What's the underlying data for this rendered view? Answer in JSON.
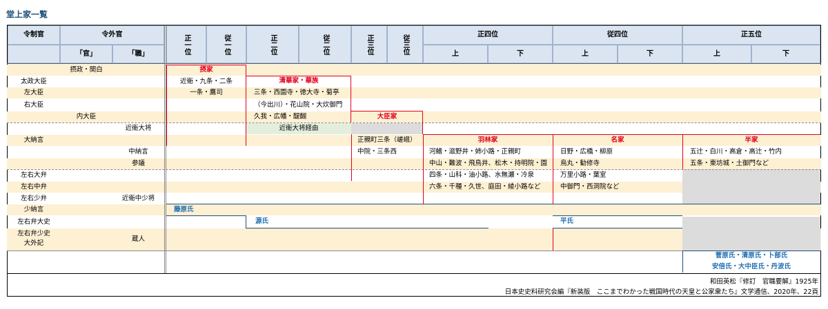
{
  "title": "堂上家一覧",
  "headers": {
    "ryoseikan": "令制官",
    "ryogekan": "令外官",
    "kan": "「官」",
    "shoku": "「職」",
    "sho1": "正一位",
    "ju1": "従一位",
    "sho2": "正二位",
    "ju2": "従二位",
    "sho3": "正三位",
    "ju3": "従三位",
    "sho4": "正四位",
    "ju4": "従四位",
    "sho5": "正五位",
    "jo": "上",
    "ge": "下"
  },
  "col1": [
    "太政大臣",
    "左大臣",
    "右大臣",
    "大納言",
    "左右大弁",
    "左右中弁",
    "左右少弁",
    "少納言",
    "左右弁大史",
    "左右弁少史\n大外記"
  ],
  "col2": [
    "摂政・関白",
    "内大臣"
  ],
  "col3": [
    "中納言",
    "参議"
  ],
  "col4": [
    "近衛大将",
    "近衛中少将",
    "蔵人"
  ],
  "groups": {
    "sekke": "摂家",
    "seiga": "清華家・華族",
    "daijin": "大臣家",
    "urin": "羽林家",
    "meika": "名家",
    "hanke": "半家",
    "fujiwara": "藤原氏",
    "minamoto": "源氏",
    "taira": "平氏",
    "others1": "菅原氏・清原氏・卜部氏",
    "others2": "安倍氏・大中臣氏・丹波氏"
  },
  "families": {
    "sekke1": "近衛・九条・二条",
    "sekke2": "一条・鷹司",
    "seiga1": "三条・西園寺・徳大寺・菊亭",
    "seiga2": "（今出川）・花山院・大炊御門",
    "seiga3": "久我・広幡・醍醐",
    "taisho": "近衛大将経由",
    "daijin1": "正親町三条（嵯峨）",
    "daijin2": "中院・三条西",
    "urin1": "河鰭・滋野井・姉小路・正親町",
    "urin2": "中山・難波・飛鳥井、松木・持明院・園",
    "urin3": "四条・山科・油小路、水無瀬・冷泉",
    "urin4": "六条・千種・久世、庭田・綾小路など",
    "meika1": "日野・広橋・柳原",
    "meika2": "烏丸・勧修寺",
    "meika3": "万里小路・葉室",
    "meika4": "中御門・西洞院など",
    "hanke1": "五辻・白川・高倉・高辻・竹内",
    "hanke2": "五条・東坊城・土御門など"
  },
  "notes": {
    "n1": "和田英松『修訂　官職要解』1925年",
    "n2": "日本史史料研究会編『新装版　ここまでわかった戦国時代の天皇と公家衆たち』文学通信、2020年、22頁"
  }
}
